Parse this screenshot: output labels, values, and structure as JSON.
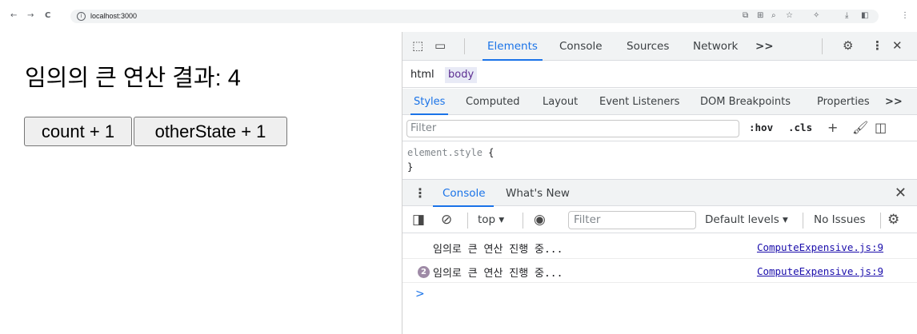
{
  "browser": {
    "back_icon": "←",
    "forward_icon": "→",
    "reload_icon": "C",
    "url": "localhost:3000",
    "toolbar_icons": [
      "screen-share-icon",
      "translate-icon",
      "zoom-icon",
      "bookmark-star-icon",
      "extensions-icon",
      "download-icon",
      "side-panel-icon",
      "menu-icon"
    ]
  },
  "page": {
    "heading": "임의의 큰 연산 결과: 4",
    "count_button": "count + 1",
    "other_button": "otherState + 1"
  },
  "devtools": {
    "tabs": [
      "Elements",
      "Console",
      "Sources",
      "Network"
    ],
    "more_tabs": ">>",
    "breadcrumbs": [
      "html",
      "body"
    ],
    "styles_tabs": [
      "Styles",
      "Computed",
      "Layout",
      "Event Listeners",
      "DOM Breakpoints",
      "Properties"
    ],
    "styles_more": ">>",
    "filter_placeholder": "Filter",
    "hov": ":hov",
    "cls": ".cls",
    "element_style": "element.style",
    "open_brace": "{",
    "close_brace": "}",
    "drawer_tabs": [
      "Console",
      "What's New"
    ],
    "console_context": "top",
    "console_filter_placeholder": "Filter",
    "log_levels": "Default levels",
    "issues": "No Issues",
    "messages": [
      {
        "text": "임의로 큰 연산 진행 중...",
        "source": "ComputeExpensive.js:9",
        "count": ""
      },
      {
        "text": "임의로 큰 연산 진행 중...",
        "source": "ComputeExpensive.js:9",
        "count": "2"
      }
    ],
    "prompt": ">"
  }
}
